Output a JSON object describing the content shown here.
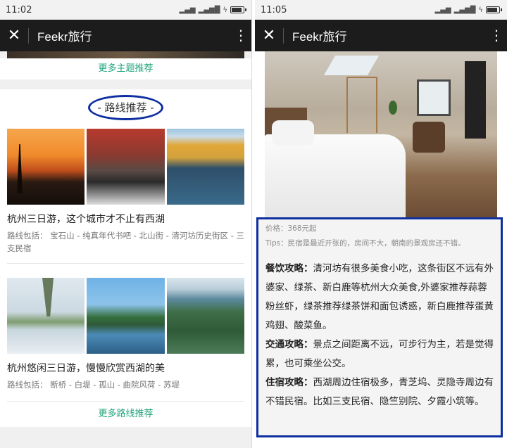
{
  "left": {
    "status_time": "11:02",
    "app_title": "Feekr旅行",
    "more_topics": "更多主题推荐",
    "section_heading": "- 路线推荐 -",
    "routes": [
      {
        "title": "杭州三日游，这个城市才不止有西湖",
        "desc": "路线包括：  宝石山 - 纯真年代书吧 - 北山街 - 清河坊历史街区 - 三支民宿"
      },
      {
        "title": "杭州悠闲三日游，慢慢欣赏西湖的美",
        "desc": "路线包括：  断桥 - 白堤 - 孤山 - 曲院风荷 - 苏堤"
      }
    ],
    "more_routes": "更多路线推荐"
  },
  "right": {
    "status_time": "11:05",
    "app_title": "Feekr旅行",
    "price": "价格：368元起",
    "tips": "Tips：民宿是最近开张的，房间不大，朝南的景观房还不错。",
    "food_label": "餐饮攻略：",
    "food_text": "清河坊有很多美食小吃，这条街区不远有外婆家、绿茶、新白鹿等杭州大众美食,外婆家推荐蒜蓉粉丝虾，绿茶推荐绿茶饼和面包诱惑，新白鹿推荐蛋黄鸡翅、酸菜鱼。",
    "transport_label": "交通攻略：",
    "transport_text": "景点之间距离不远，可步行为主，若是觉得累，也可乘坐公交。",
    "stay_label": "住宿攻略：",
    "stay_text": "西湖周边住宿极多，青芝坞、灵隐寺周边有不错民宿。比如三支民宿、隐竺别院、夕霞小筑等。"
  },
  "colors": {
    "highlight_border": "#0d2fa0",
    "link_green": "#1fa37a",
    "title_bar": "#1c1c1c"
  }
}
